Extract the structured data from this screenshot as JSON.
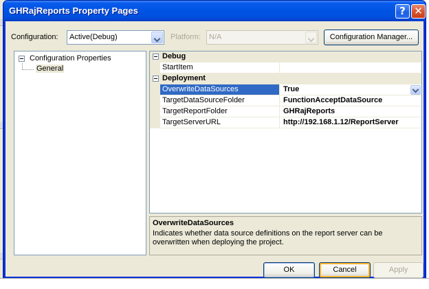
{
  "window": {
    "title": "GHRajReports Property Pages"
  },
  "toolbar": {
    "configuration_label": "Configuration:",
    "configuration_value": "Active(Debug)",
    "platform_label": "Platform:",
    "platform_value": "N/A",
    "configuration_manager_label": "Configuration Manager..."
  },
  "tree": {
    "root_label": "Configuration Properties",
    "child_label": "General"
  },
  "grid": {
    "categories": [
      {
        "label": "Debug",
        "properties": [
          {
            "name": "StartItem",
            "value": ""
          }
        ]
      },
      {
        "label": "Deployment",
        "properties": [
          {
            "name": "OverwriteDataSources",
            "value": "True"
          },
          {
            "name": "TargetDataSourceFolder",
            "value": "FunctionAcceptDataSource"
          },
          {
            "name": "TargetReportFolder",
            "value": "GHRajReports"
          },
          {
            "name": "TargetServerURL",
            "value": "http://192.168.1.12/ReportServer"
          }
        ]
      }
    ]
  },
  "description": {
    "title": "OverwriteDataSources",
    "text": "Indicates whether data source definitions on the report server can be overwritten when deploying the project."
  },
  "buttons": {
    "ok_label": "OK",
    "cancel_label": "Cancel",
    "apply_label": "Apply"
  },
  "colors": {
    "title_bar": "#0054e3",
    "selection": "#316ac5",
    "face": "#ece9d8"
  }
}
